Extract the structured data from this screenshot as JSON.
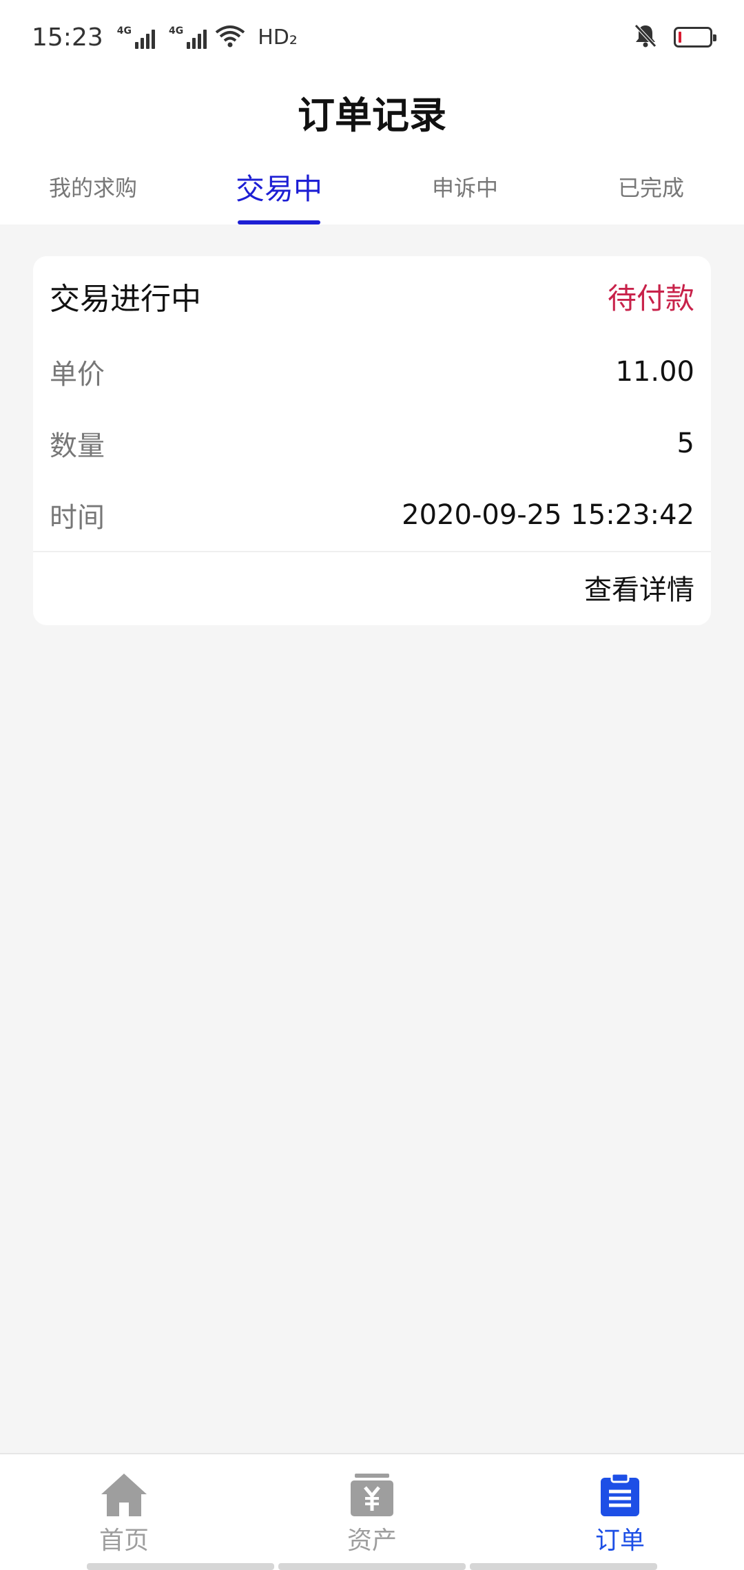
{
  "status_bar": {
    "time": "15:23",
    "signal_label_1": "4G",
    "signal_label_2": "4G",
    "hd_label": "HD₂"
  },
  "header": {
    "title": "订单记录"
  },
  "tabs": [
    {
      "label": "我的求购",
      "active": false
    },
    {
      "label": "交易中",
      "active": true
    },
    {
      "label": "申诉中",
      "active": false
    },
    {
      "label": "已完成",
      "active": false
    }
  ],
  "order": {
    "title": "交易进行中",
    "status": "待付款",
    "rows": [
      {
        "key": "单价",
        "value": "11.00"
      },
      {
        "key": "数量",
        "value": "5"
      },
      {
        "key": "时间",
        "value": "2020-09-25 15:23:42"
      }
    ],
    "detail_label": "查看详情"
  },
  "bottom_nav": [
    {
      "label": "首页",
      "icon": "home-icon",
      "active": false
    },
    {
      "label": "资产",
      "icon": "wallet-yen-icon",
      "active": false
    },
    {
      "label": "订单",
      "icon": "clipboard-icon",
      "active": true
    }
  ],
  "colors": {
    "accent": "#1d1fd4",
    "nav_active": "#1d4fe6",
    "status_pending": "#c8224a",
    "background": "#f5f5f5"
  }
}
